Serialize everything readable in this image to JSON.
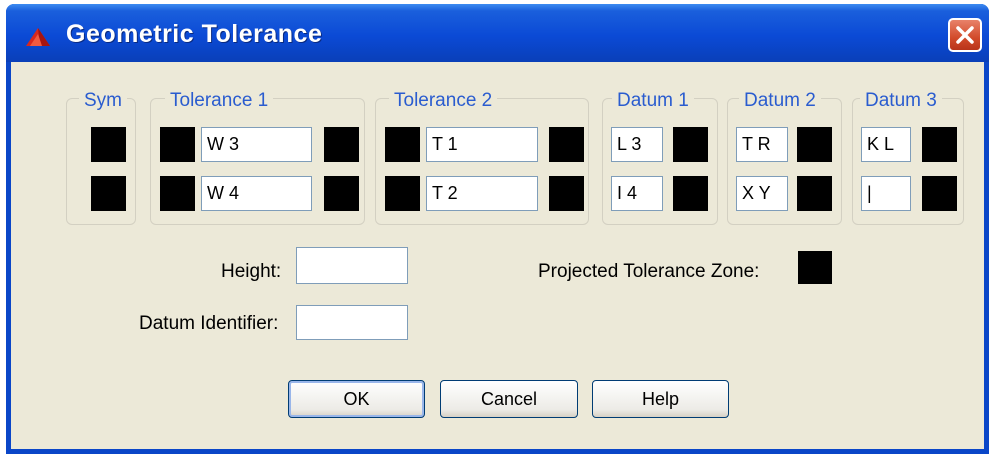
{
  "window": {
    "title": "Geometric Tolerance",
    "icon": "autocad-app-icon",
    "close_icon": "close-icon"
  },
  "groups": {
    "sym": "Sym",
    "tolerance1": "Tolerance 1",
    "tolerance2": "Tolerance 2",
    "datum1": "Datum 1",
    "datum2": "Datum 2",
    "datum3": "Datum 3"
  },
  "rows": [
    {
      "tolerance1": "W 3",
      "tolerance2": "T 1",
      "datum1": "L 3",
      "datum2": "T R",
      "datum3": "K L"
    },
    {
      "tolerance1": "W 4",
      "tolerance2": "T 2",
      "datum1": "I 4",
      "datum2": "X Y",
      "datum3": "|"
    }
  ],
  "fields": {
    "height_label": "Height:",
    "height_value": "",
    "datum_identifier_label": "Datum Identifier:",
    "datum_identifier_value": "",
    "projected_zone_label": "Projected Tolerance Zone:"
  },
  "buttons": {
    "ok": "OK",
    "cancel": "Cancel",
    "help": "Help"
  },
  "colors": {
    "title_bar": "#0a46c8",
    "dialog_bg": "#ece9d8",
    "legend_text": "#2a5ccf",
    "close": "#d24a2a"
  }
}
